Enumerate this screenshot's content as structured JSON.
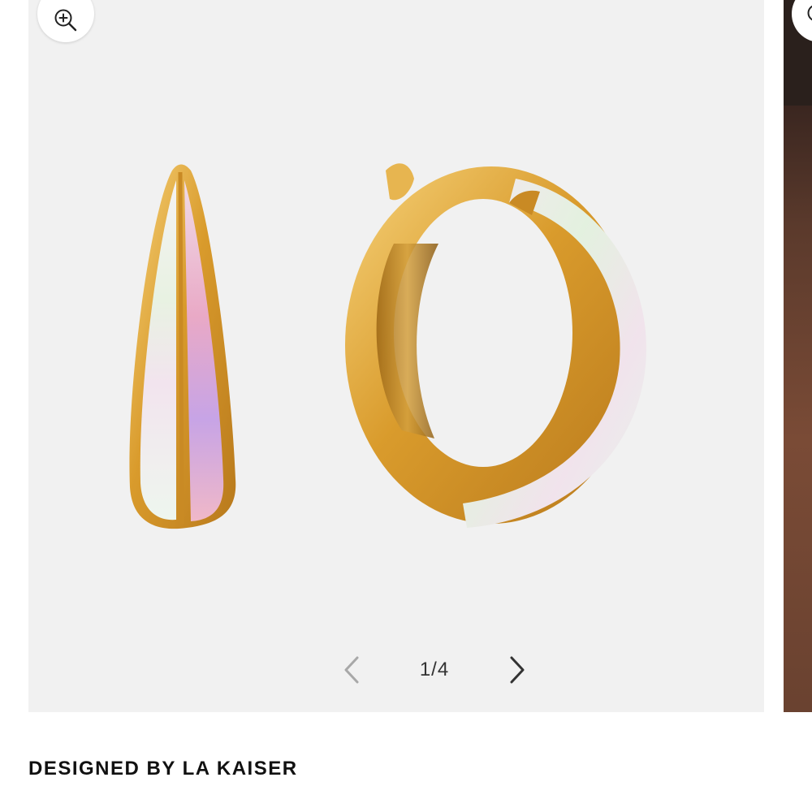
{
  "gallery": {
    "current_page": 1,
    "total_pages": 4,
    "pager_text": "1/4",
    "zoom_icon": "zoom-in-icon",
    "prev_icon": "chevron-left-icon",
    "next_icon": "chevron-right-icon",
    "background_color": "#f1f1f1"
  },
  "product": {
    "designer_line": "DESIGNED BY LA KAISER",
    "image_subject": "gold hoop earrings with opal inlay"
  },
  "colors": {
    "gold": "#d9a43a",
    "opal": "#f3e9ef",
    "text": "#111111"
  }
}
